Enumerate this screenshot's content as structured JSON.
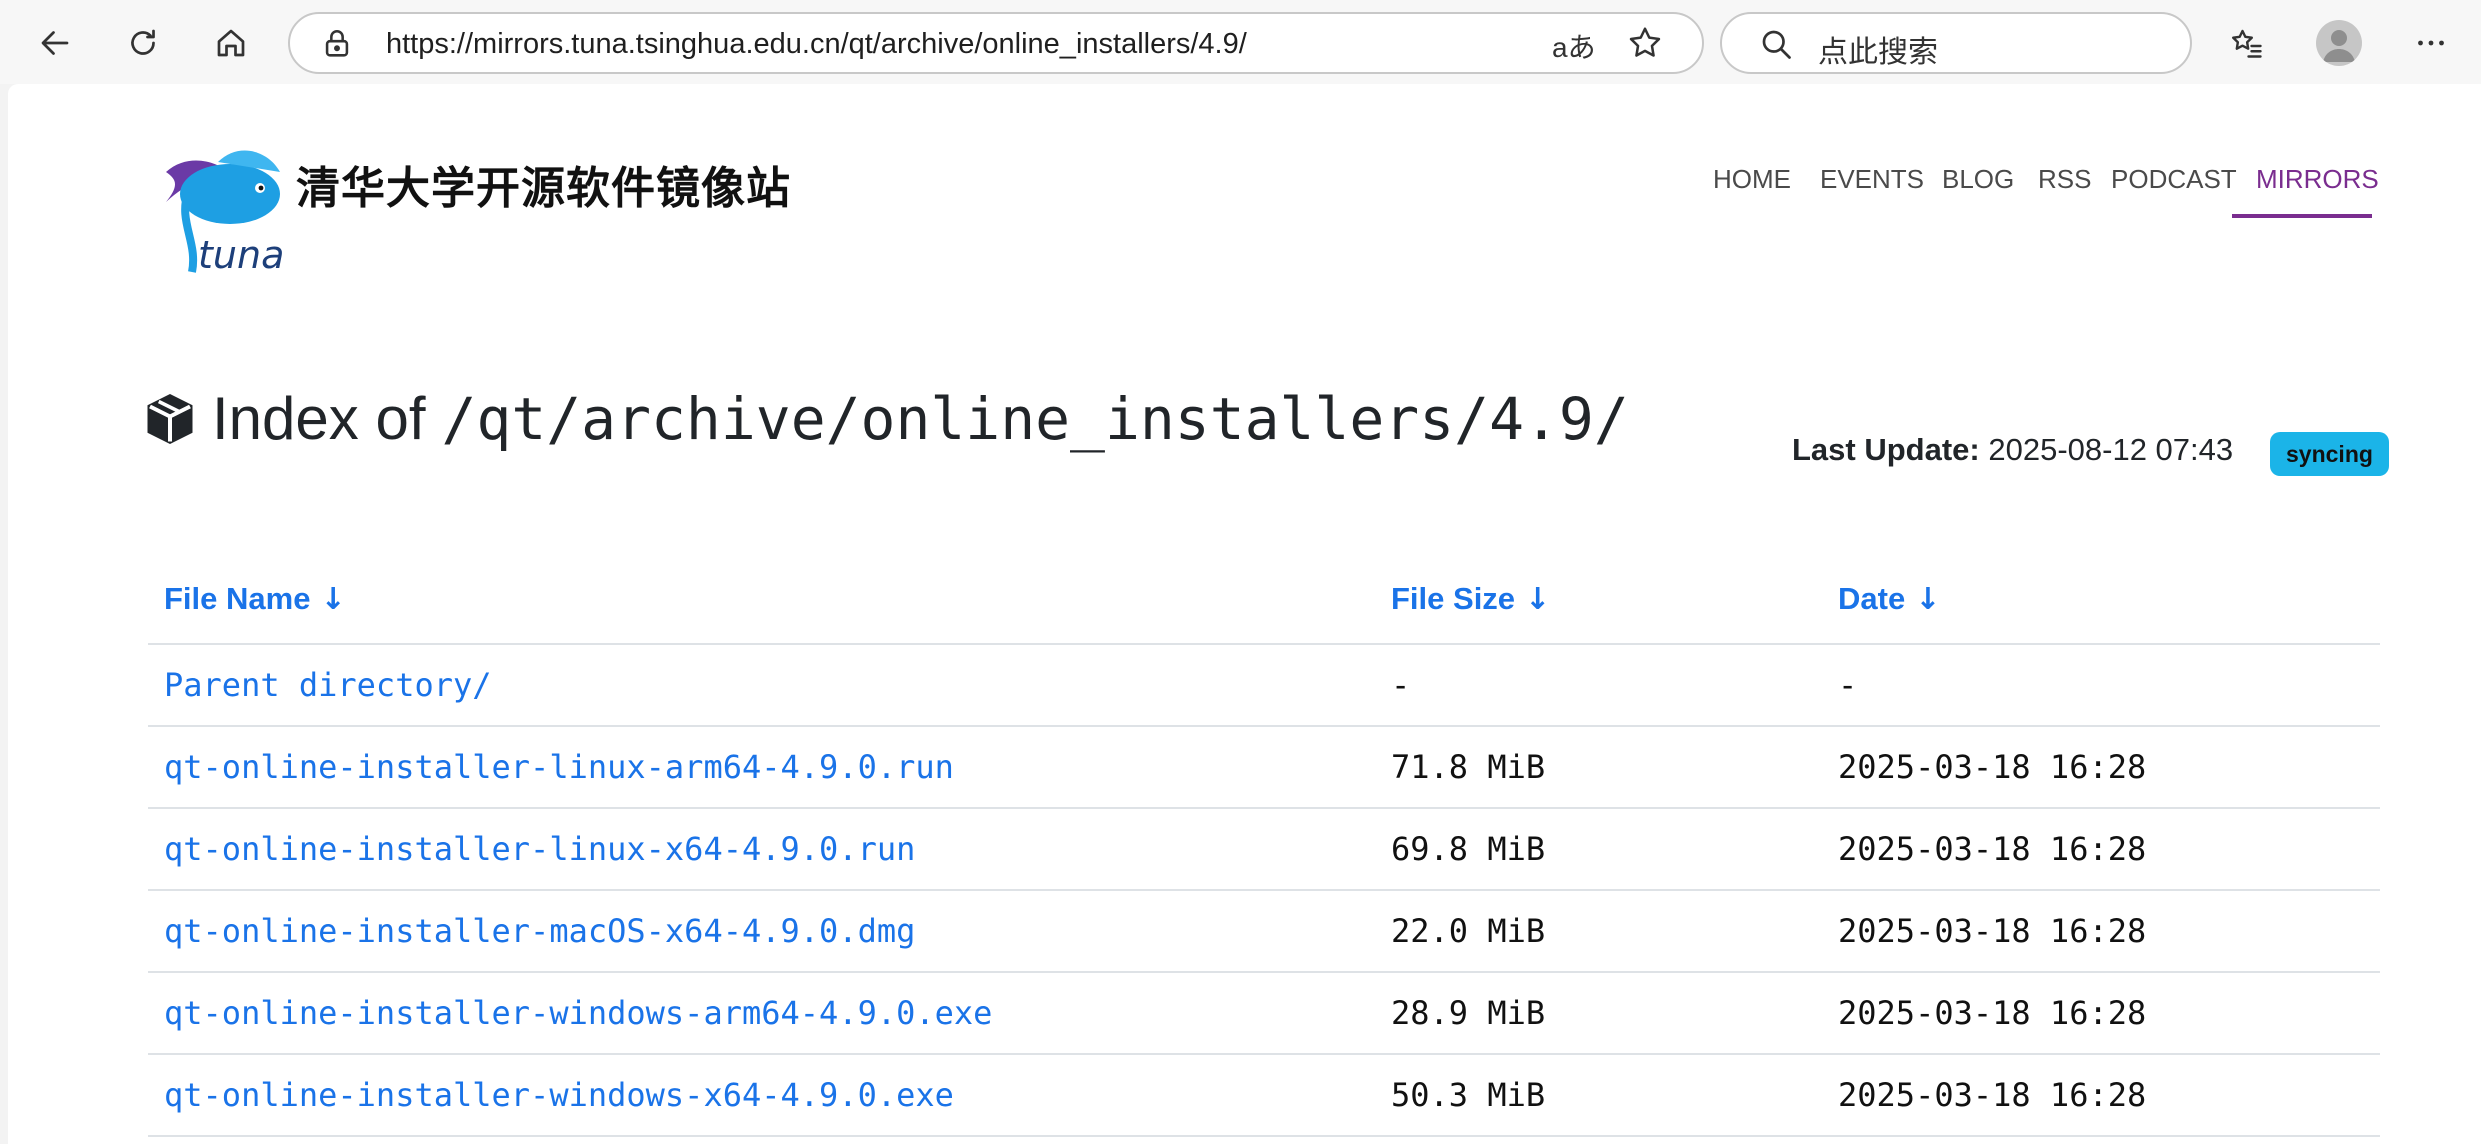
{
  "browser": {
    "url": "https://mirrors.tuna.tsinghua.edu.cn/qt/archive/online_installers/4.9/",
    "read_aloud_label": "aあ",
    "search_placeholder": "点此搜索"
  },
  "site": {
    "logo_text": "tuna",
    "title": "清华大学开源软件镜像站"
  },
  "nav": {
    "items": [
      {
        "label": "HOME",
        "active": false
      },
      {
        "label": "EVENTS",
        "active": false
      },
      {
        "label": "BLOG",
        "active": false
      },
      {
        "label": "RSS",
        "active": false
      },
      {
        "label": "PODCAST",
        "active": false
      },
      {
        "label": "MIRRORS",
        "active": true
      }
    ],
    "active_color": "#7a2d8f"
  },
  "index": {
    "label": "Index of",
    "path": "/qt/archive/online_installers/4.9/",
    "last_update_label": "Last Update:",
    "last_update_value": "2025-08-12 07:43",
    "status_badge": "syncing",
    "badge_color": "#1bb4e8",
    "link_color": "#1a73e8"
  },
  "table": {
    "headers": {
      "name": "File Name",
      "size": "File Size",
      "date": "Date",
      "sort_arrow": "↓"
    },
    "rows": [
      {
        "name": "Parent directory/",
        "size": "-",
        "date": "-"
      },
      {
        "name": "qt-online-installer-linux-arm64-4.9.0.run",
        "size": "71.8 MiB",
        "date": "2025-03-18 16:28"
      },
      {
        "name": "qt-online-installer-linux-x64-4.9.0.run",
        "size": "69.8 MiB",
        "date": "2025-03-18 16:28"
      },
      {
        "name": "qt-online-installer-macOS-x64-4.9.0.dmg",
        "size": "22.0 MiB",
        "date": "2025-03-18 16:28"
      },
      {
        "name": "qt-online-installer-windows-arm64-4.9.0.exe",
        "size": "28.9 MiB",
        "date": "2025-03-18 16:28"
      },
      {
        "name": "qt-online-installer-windows-x64-4.9.0.exe",
        "size": "50.3 MiB",
        "date": "2025-03-18 16:28"
      }
    ]
  }
}
